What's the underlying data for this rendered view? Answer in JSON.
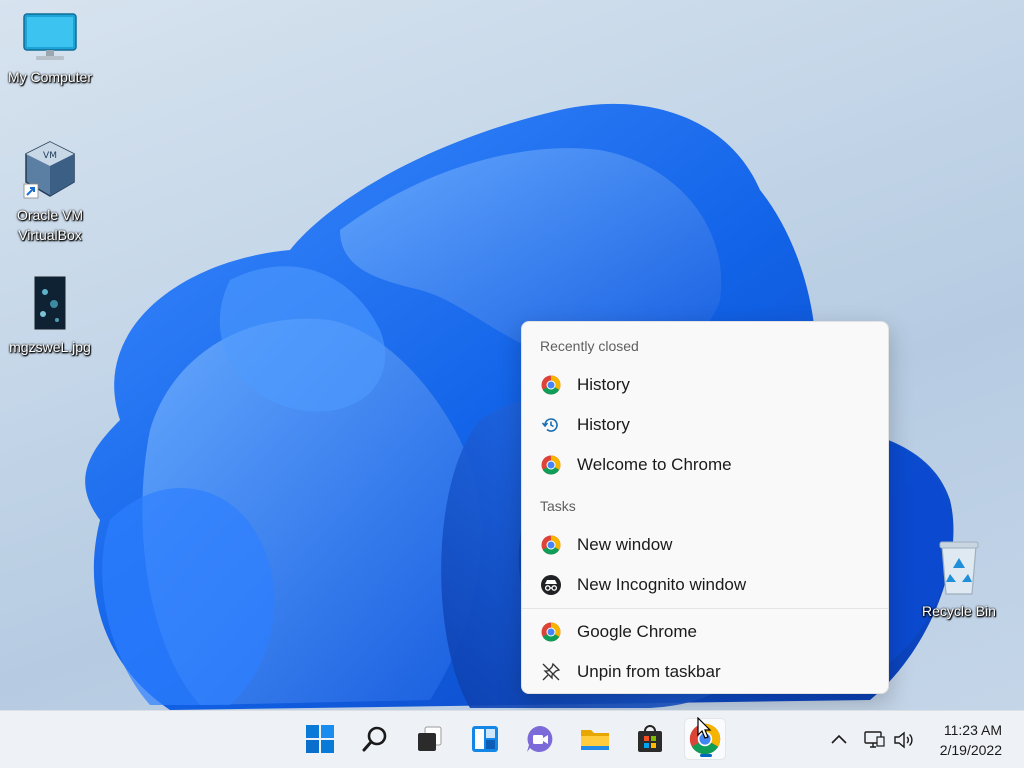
{
  "desktop": {
    "icons": [
      {
        "label": "My Computer"
      },
      {
        "label_line1": "Oracle VM",
        "label_line2": "VirtualBox"
      },
      {
        "label": "mgzsweL.jpg"
      },
      {
        "label": "Recycle Bin"
      }
    ]
  },
  "jumplist": {
    "recently_closed_header": "Recently closed",
    "recent_items": [
      {
        "label": "History",
        "icon": "chrome-icon"
      },
      {
        "label": "History",
        "icon": "history-icon"
      },
      {
        "label": "Welcome to Chrome",
        "icon": "chrome-icon"
      }
    ],
    "tasks_header": "Tasks",
    "task_items": [
      {
        "label": "New window",
        "icon": "chrome-icon"
      },
      {
        "label": "New Incognito window",
        "icon": "incognito-icon"
      }
    ],
    "app_items": [
      {
        "label": "Google Chrome",
        "icon": "chrome-icon"
      },
      {
        "label": "Unpin from taskbar",
        "icon": "unpin-icon"
      }
    ]
  },
  "taskbar": {
    "apps": [
      "start-icon",
      "search-icon",
      "task-view-icon",
      "widgets-icon",
      "chat-icon",
      "file-explorer-icon",
      "store-icon",
      "chrome-icon"
    ],
    "clock": {
      "time": "11:23 AM",
      "date": "2/19/2022"
    }
  },
  "colors": {
    "accent": "#0067c0",
    "wallpaper_blue": "#1a6cf0"
  }
}
